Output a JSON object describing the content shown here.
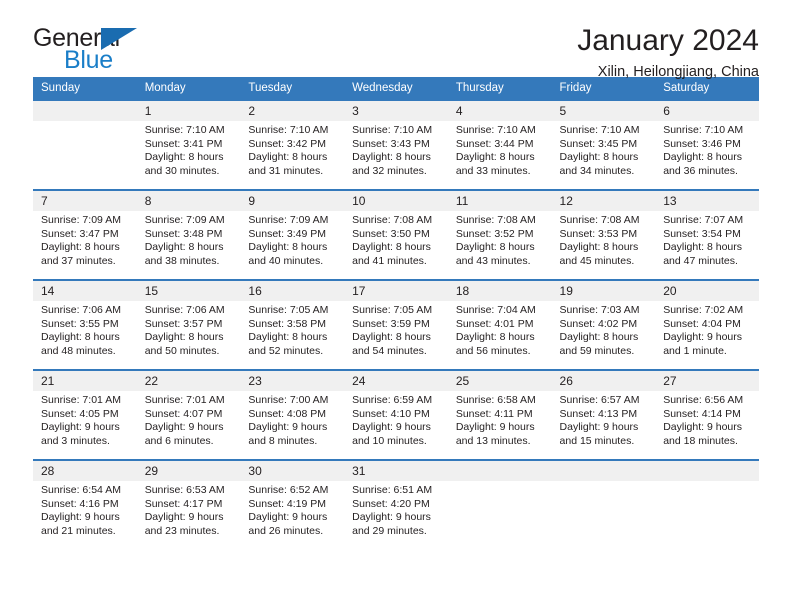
{
  "brand": {
    "name_part1": "General",
    "name_part2": "Blue",
    "triangle_icon": "triangle-icon",
    "accent_blue": "#1a7ec8",
    "dark_blue": "#1a6cb0"
  },
  "header": {
    "title": "January 2024",
    "subtitle": "Xilin, Heilongjiang, China",
    "header_bg": "#3479bb",
    "daynum_bg": "#f0f0f0"
  },
  "weekday_headers": [
    "Sunday",
    "Monday",
    "Tuesday",
    "Wednesday",
    "Thursday",
    "Friday",
    "Saturday"
  ],
  "weeks": [
    [
      {
        "day": "",
        "sunrise": "",
        "sunset": "",
        "daylight_line1": "",
        "daylight_line2": ""
      },
      {
        "day": "1",
        "sunrise": "Sunrise: 7:10 AM",
        "sunset": "Sunset: 3:41 PM",
        "daylight_line1": "Daylight: 8 hours",
        "daylight_line2": "and 30 minutes."
      },
      {
        "day": "2",
        "sunrise": "Sunrise: 7:10 AM",
        "sunset": "Sunset: 3:42 PM",
        "daylight_line1": "Daylight: 8 hours",
        "daylight_line2": "and 31 minutes."
      },
      {
        "day": "3",
        "sunrise": "Sunrise: 7:10 AM",
        "sunset": "Sunset: 3:43 PM",
        "daylight_line1": "Daylight: 8 hours",
        "daylight_line2": "and 32 minutes."
      },
      {
        "day": "4",
        "sunrise": "Sunrise: 7:10 AM",
        "sunset": "Sunset: 3:44 PM",
        "daylight_line1": "Daylight: 8 hours",
        "daylight_line2": "and 33 minutes."
      },
      {
        "day": "5",
        "sunrise": "Sunrise: 7:10 AM",
        "sunset": "Sunset: 3:45 PM",
        "daylight_line1": "Daylight: 8 hours",
        "daylight_line2": "and 34 minutes."
      },
      {
        "day": "6",
        "sunrise": "Sunrise: 7:10 AM",
        "sunset": "Sunset: 3:46 PM",
        "daylight_line1": "Daylight: 8 hours",
        "daylight_line2": "and 36 minutes."
      }
    ],
    [
      {
        "day": "7",
        "sunrise": "Sunrise: 7:09 AM",
        "sunset": "Sunset: 3:47 PM",
        "daylight_line1": "Daylight: 8 hours",
        "daylight_line2": "and 37 minutes."
      },
      {
        "day": "8",
        "sunrise": "Sunrise: 7:09 AM",
        "sunset": "Sunset: 3:48 PM",
        "daylight_line1": "Daylight: 8 hours",
        "daylight_line2": "and 38 minutes."
      },
      {
        "day": "9",
        "sunrise": "Sunrise: 7:09 AM",
        "sunset": "Sunset: 3:49 PM",
        "daylight_line1": "Daylight: 8 hours",
        "daylight_line2": "and 40 minutes."
      },
      {
        "day": "10",
        "sunrise": "Sunrise: 7:08 AM",
        "sunset": "Sunset: 3:50 PM",
        "daylight_line1": "Daylight: 8 hours",
        "daylight_line2": "and 41 minutes."
      },
      {
        "day": "11",
        "sunrise": "Sunrise: 7:08 AM",
        "sunset": "Sunset: 3:52 PM",
        "daylight_line1": "Daylight: 8 hours",
        "daylight_line2": "and 43 minutes."
      },
      {
        "day": "12",
        "sunrise": "Sunrise: 7:08 AM",
        "sunset": "Sunset: 3:53 PM",
        "daylight_line1": "Daylight: 8 hours",
        "daylight_line2": "and 45 minutes."
      },
      {
        "day": "13",
        "sunrise": "Sunrise: 7:07 AM",
        "sunset": "Sunset: 3:54 PM",
        "daylight_line1": "Daylight: 8 hours",
        "daylight_line2": "and 47 minutes."
      }
    ],
    [
      {
        "day": "14",
        "sunrise": "Sunrise: 7:06 AM",
        "sunset": "Sunset: 3:55 PM",
        "daylight_line1": "Daylight: 8 hours",
        "daylight_line2": "and 48 minutes."
      },
      {
        "day": "15",
        "sunrise": "Sunrise: 7:06 AM",
        "sunset": "Sunset: 3:57 PM",
        "daylight_line1": "Daylight: 8 hours",
        "daylight_line2": "and 50 minutes."
      },
      {
        "day": "16",
        "sunrise": "Sunrise: 7:05 AM",
        "sunset": "Sunset: 3:58 PM",
        "daylight_line1": "Daylight: 8 hours",
        "daylight_line2": "and 52 minutes."
      },
      {
        "day": "17",
        "sunrise": "Sunrise: 7:05 AM",
        "sunset": "Sunset: 3:59 PM",
        "daylight_line1": "Daylight: 8 hours",
        "daylight_line2": "and 54 minutes."
      },
      {
        "day": "18",
        "sunrise": "Sunrise: 7:04 AM",
        "sunset": "Sunset: 4:01 PM",
        "daylight_line1": "Daylight: 8 hours",
        "daylight_line2": "and 56 minutes."
      },
      {
        "day": "19",
        "sunrise": "Sunrise: 7:03 AM",
        "sunset": "Sunset: 4:02 PM",
        "daylight_line1": "Daylight: 8 hours",
        "daylight_line2": "and 59 minutes."
      },
      {
        "day": "20",
        "sunrise": "Sunrise: 7:02 AM",
        "sunset": "Sunset: 4:04 PM",
        "daylight_line1": "Daylight: 9 hours",
        "daylight_line2": "and 1 minute."
      }
    ],
    [
      {
        "day": "21",
        "sunrise": "Sunrise: 7:01 AM",
        "sunset": "Sunset: 4:05 PM",
        "daylight_line1": "Daylight: 9 hours",
        "daylight_line2": "and 3 minutes."
      },
      {
        "day": "22",
        "sunrise": "Sunrise: 7:01 AM",
        "sunset": "Sunset: 4:07 PM",
        "daylight_line1": "Daylight: 9 hours",
        "daylight_line2": "and 6 minutes."
      },
      {
        "day": "23",
        "sunrise": "Sunrise: 7:00 AM",
        "sunset": "Sunset: 4:08 PM",
        "daylight_line1": "Daylight: 9 hours",
        "daylight_line2": "and 8 minutes."
      },
      {
        "day": "24",
        "sunrise": "Sunrise: 6:59 AM",
        "sunset": "Sunset: 4:10 PM",
        "daylight_line1": "Daylight: 9 hours",
        "daylight_line2": "and 10 minutes."
      },
      {
        "day": "25",
        "sunrise": "Sunrise: 6:58 AM",
        "sunset": "Sunset: 4:11 PM",
        "daylight_line1": "Daylight: 9 hours",
        "daylight_line2": "and 13 minutes."
      },
      {
        "day": "26",
        "sunrise": "Sunrise: 6:57 AM",
        "sunset": "Sunset: 4:13 PM",
        "daylight_line1": "Daylight: 9 hours",
        "daylight_line2": "and 15 minutes."
      },
      {
        "day": "27",
        "sunrise": "Sunrise: 6:56 AM",
        "sunset": "Sunset: 4:14 PM",
        "daylight_line1": "Daylight: 9 hours",
        "daylight_line2": "and 18 minutes."
      }
    ],
    [
      {
        "day": "28",
        "sunrise": "Sunrise: 6:54 AM",
        "sunset": "Sunset: 4:16 PM",
        "daylight_line1": "Daylight: 9 hours",
        "daylight_line2": "and 21 minutes."
      },
      {
        "day": "29",
        "sunrise": "Sunrise: 6:53 AM",
        "sunset": "Sunset: 4:17 PM",
        "daylight_line1": "Daylight: 9 hours",
        "daylight_line2": "and 23 minutes."
      },
      {
        "day": "30",
        "sunrise": "Sunrise: 6:52 AM",
        "sunset": "Sunset: 4:19 PM",
        "daylight_line1": "Daylight: 9 hours",
        "daylight_line2": "and 26 minutes."
      },
      {
        "day": "31",
        "sunrise": "Sunrise: 6:51 AM",
        "sunset": "Sunset: 4:20 PM",
        "daylight_line1": "Daylight: 9 hours",
        "daylight_line2": "and 29 minutes."
      },
      {
        "day": "",
        "sunrise": "",
        "sunset": "",
        "daylight_line1": "",
        "daylight_line2": ""
      },
      {
        "day": "",
        "sunrise": "",
        "sunset": "",
        "daylight_line1": "",
        "daylight_line2": ""
      },
      {
        "day": "",
        "sunrise": "",
        "sunset": "",
        "daylight_line1": "",
        "daylight_line2": ""
      }
    ]
  ]
}
